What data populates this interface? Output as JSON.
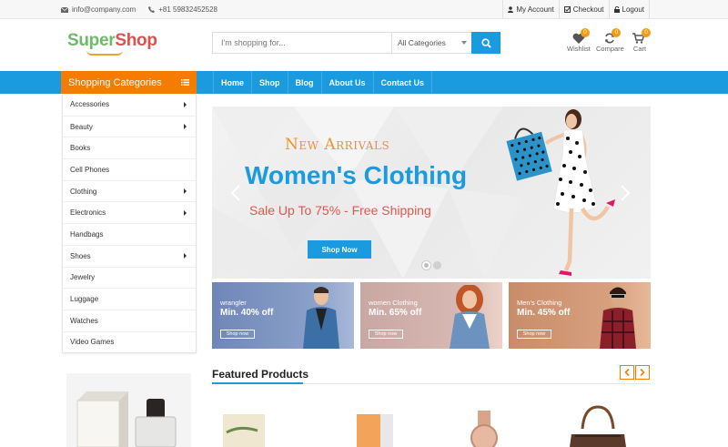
{
  "topbar": {
    "email": "info@company.com",
    "phone": "+81 59832452528",
    "links": [
      "My Account",
      "Checkout",
      "Logout"
    ]
  },
  "header": {
    "logo_part1": "Super",
    "logo_part2": "Shop",
    "search_placeholder": "I'm shopping for...",
    "category_select": "All Categories",
    "icons": [
      {
        "label": "Wishlist",
        "count": "0"
      },
      {
        "label": "Compare",
        "count": "0"
      },
      {
        "label": "Cart",
        "count": "0"
      }
    ]
  },
  "nav": {
    "categories_title": "Shopping Categories",
    "menu": [
      "Home",
      "Shop",
      "Blog",
      "About Us",
      "Contact Us"
    ]
  },
  "categories": [
    {
      "label": "Accessories",
      "has_sub": true
    },
    {
      "label": "Beauty",
      "has_sub": true
    },
    {
      "label": "Books",
      "has_sub": false
    },
    {
      "label": "Cell Phones",
      "has_sub": false
    },
    {
      "label": "Clothing",
      "has_sub": true
    },
    {
      "label": "Electronics",
      "has_sub": true
    },
    {
      "label": "Handbags",
      "has_sub": false
    },
    {
      "label": "Shoes",
      "has_sub": true
    },
    {
      "label": "Jewelry",
      "has_sub": false
    },
    {
      "label": "Luggage",
      "has_sub": false
    },
    {
      "label": "Watches",
      "has_sub": false
    },
    {
      "label": "Video Games",
      "has_sub": false
    }
  ],
  "hero": {
    "subtitle": "New Arrivals",
    "title": "Women's Clothing",
    "sale": "Sale Up To 75% - Free Shipping",
    "button": "Shop Now"
  },
  "banners": [
    {
      "small": "wrangler",
      "big": "Min. 40% off",
      "button": "Shop now"
    },
    {
      "small": "women Clothing",
      "big": "Min. 65% off",
      "button": "Shop now"
    },
    {
      "small": "Men's Clothing",
      "big": "Min. 45% off",
      "button": "Shop now"
    }
  ],
  "featured": {
    "title": "Featured Products"
  },
  "colors": {
    "primary": "#1a9be0",
    "accent": "#f57c00",
    "logo_green": "#6dba6a",
    "logo_red": "#d9534f"
  }
}
